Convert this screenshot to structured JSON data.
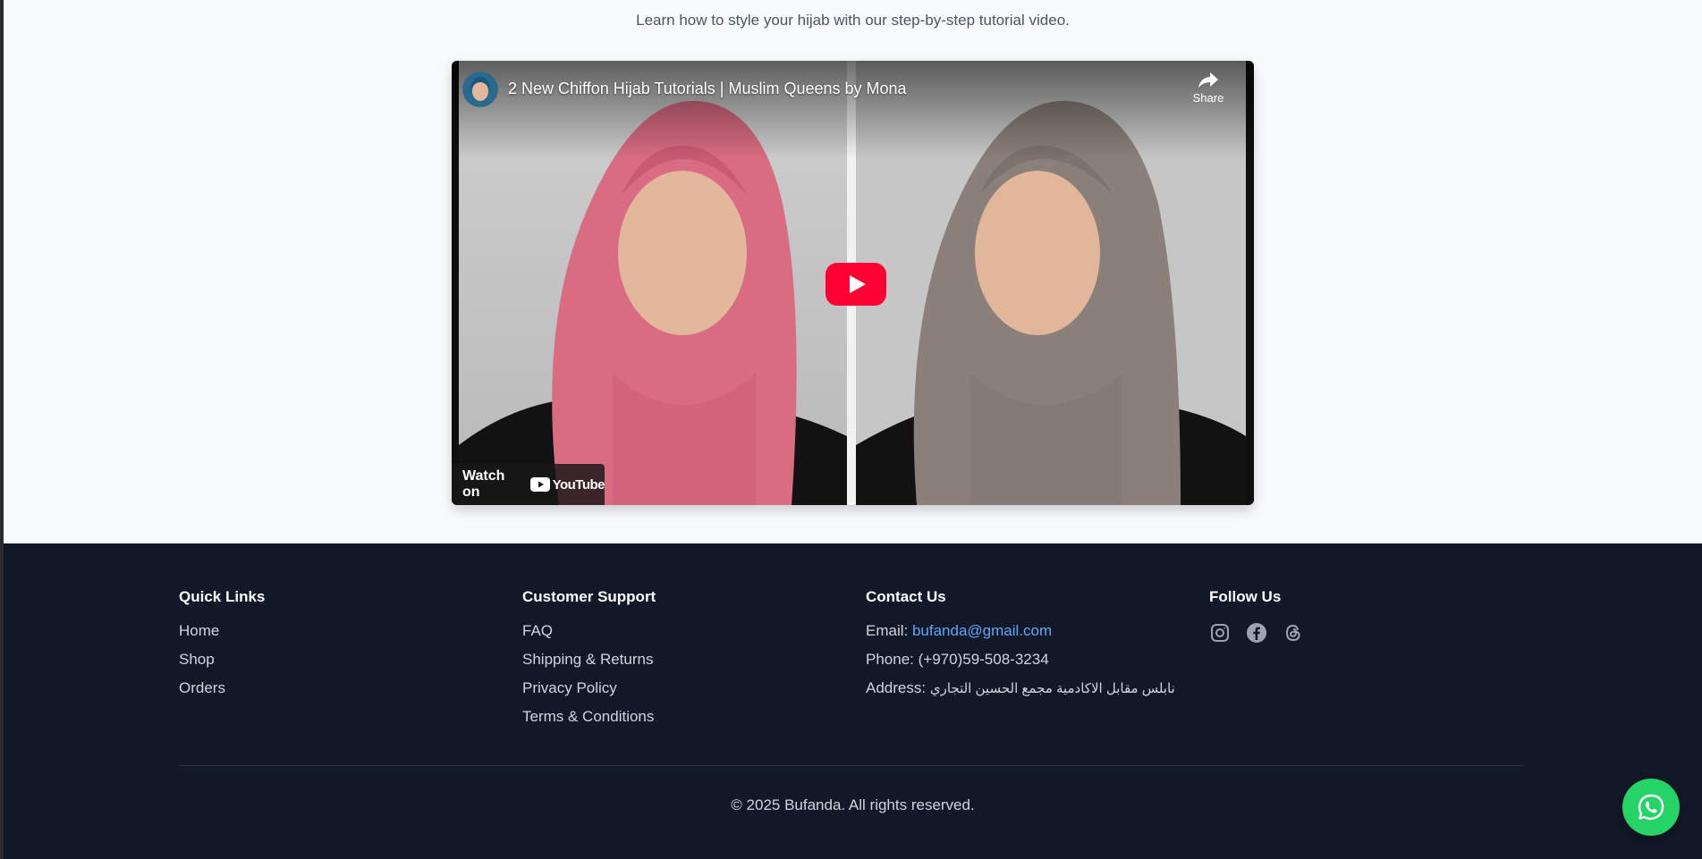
{
  "tutorial": {
    "subtitle": "Learn how to style your hijab with our step-by-step tutorial video."
  },
  "video": {
    "title": "2 New Chiffon Hijab Tutorials | Muslim Queens by Mona",
    "share_label": "Share",
    "watch_on_label": "Watch on",
    "youtube_label": "YouTube",
    "play_color": "#ff0033"
  },
  "footer": {
    "quick_links": {
      "heading": "Quick Links",
      "items": [
        "Home",
        "Shop",
        "Orders"
      ]
    },
    "support": {
      "heading": "Customer Support",
      "items": [
        "FAQ",
        "Shipping & Returns",
        "Privacy Policy",
        "Terms & Conditions"
      ]
    },
    "contact": {
      "heading": "Contact Us",
      "email_label": "Email:",
      "email": "bufanda@gmail.com",
      "phone_label": "Phone:",
      "phone": "(+970)59-508-3234",
      "address_label": "Address:",
      "address": "نابلس مقابل الاكادمية مجمع الحسين التجاري"
    },
    "follow": {
      "heading": "Follow Us",
      "icons": [
        "instagram-icon",
        "facebook-icon",
        "threads-icon"
      ]
    },
    "copyright": "© 2025 Bufanda. All rights reserved."
  },
  "colors": {
    "footer_bg": "#111827",
    "link": "#60a5fa",
    "whatsapp": "#25d366"
  }
}
